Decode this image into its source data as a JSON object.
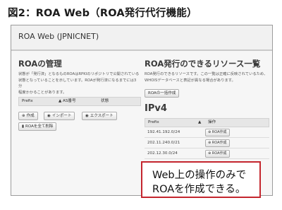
{
  "figure_title": "図2：ROA Web（ROA発行代行機能）",
  "app": {
    "title": "ROA Web (JPNICNET)"
  },
  "left": {
    "heading": "ROAの管理",
    "desc_lines": [
      "状態が「発行済」となるものROAはRPKIのリポジトリで公開されている",
      "状態となっていることを示しています。ROAが発行済になるまでには3分",
      "程度かかることがあります。"
    ],
    "table_headers": {
      "prefix": "Prefix",
      "as": "AS番号",
      "status": "状態"
    },
    "buttons": {
      "create": "作成",
      "import": "インポート",
      "export": "エクスポート",
      "delete_all": "ROAを全て削除"
    }
  },
  "right": {
    "heading": "ROA発行のできるリソース一覧",
    "desc_lines": [
      "ROA発行のできるリソースです。この一覧は正確に反映されているため、",
      "WHOISデータベースと表記が異なる場合があります。"
    ],
    "list_button": "ROAの一括作成",
    "ipv4_heading": "IPv4",
    "table_headers": {
      "prefix": "Prefix",
      "action": "操作"
    },
    "rows": [
      {
        "prefix": "192.41.192.0/24",
        "action": "ROA作成"
      },
      {
        "prefix": "202.11.240.0/21",
        "action": "ROA作成"
      },
      {
        "prefix": "202.12.30.0/24",
        "action": "ROA作成"
      }
    ]
  },
  "callout": {
    "line1": "Web上の操作のみで",
    "line2": "ROAを作成できる。"
  },
  "colors": {
    "callout_border": "#c4262e",
    "header_bg": "#e6e6e6"
  },
  "icons": {
    "create": "plus-circle-icon",
    "import": "import-icon",
    "export": "export-icon",
    "delete": "trash-icon",
    "row_action": "plus-circle-icon"
  }
}
